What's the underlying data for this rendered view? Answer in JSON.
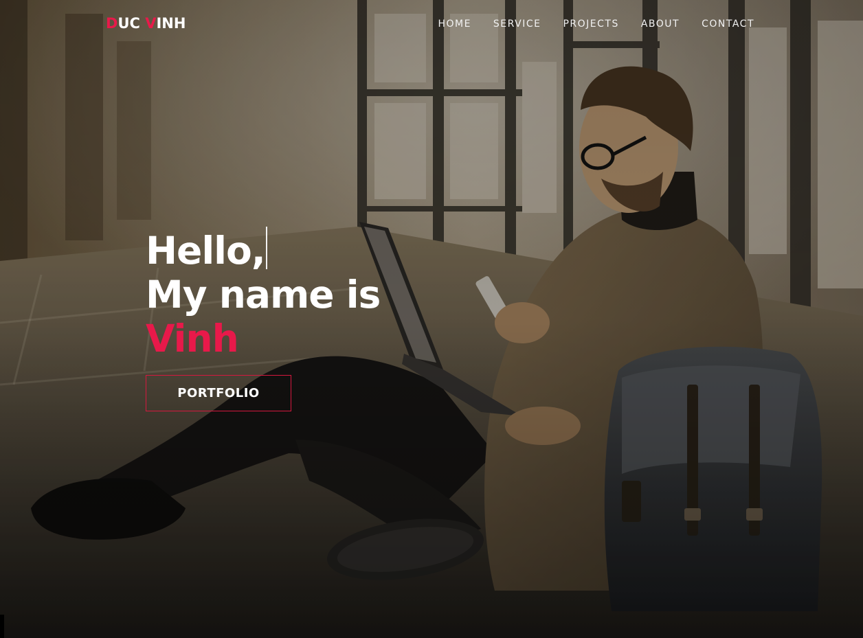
{
  "brand": {
    "logo_first_initial": "D",
    "logo_first_rest": "UC ",
    "logo_second_initial": "V",
    "logo_second_rest": "INH"
  },
  "nav": {
    "items": [
      "HOME",
      "SERVICE",
      "PROJECTS",
      "ABOUT",
      "CONTACT"
    ]
  },
  "hero": {
    "greeting": "Hello,",
    "intro": "My name is",
    "name": "Vinh",
    "cta_label": "PORTFOLIO"
  },
  "colors": {
    "accent": "#e8194a",
    "text": "#ffffff",
    "overlay": "#1a1714"
  },
  "icons": {
    "background": "photo-man-with-laptop-and-backpack"
  }
}
